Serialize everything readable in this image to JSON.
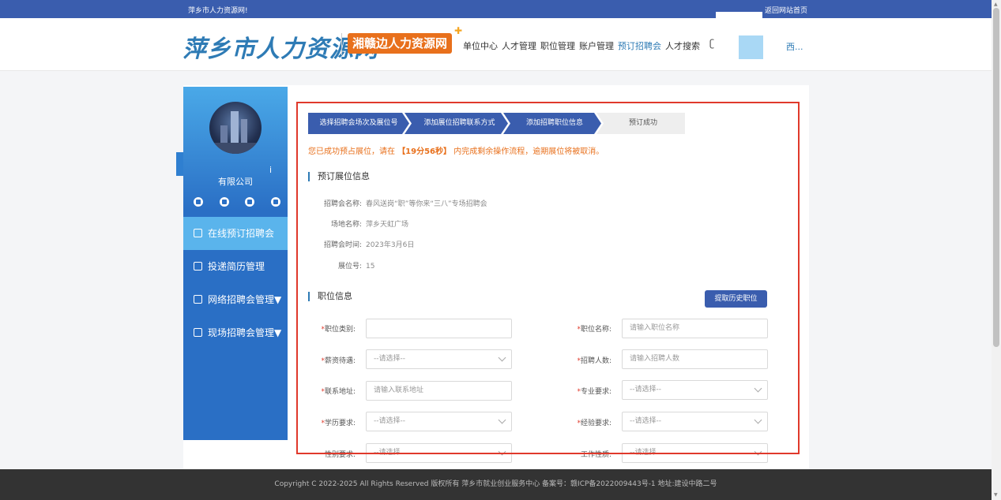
{
  "topbar": {
    "site_title": "萍乡市人力资源网!",
    "home_link": "返回网站首页"
  },
  "header": {
    "logo_main": "萍乡市人力资源网",
    "logo_badge": "湘赣边人力资源网",
    "nav": [
      "单位中心",
      "人才管理",
      "职位管理",
      "账户管理",
      "预订招聘会",
      "人才搜索"
    ],
    "nav_active_index": 4,
    "user_name": "西..."
  },
  "sidebar": {
    "info_mark": "i",
    "company": "有限公司",
    "menu": [
      {
        "label": "在线预订招聘会",
        "active": true
      },
      {
        "label": "投递简历管理",
        "active": false
      },
      {
        "label": "网络招聘会管理▼",
        "active": false
      },
      {
        "label": "现场招聘会管理▼",
        "active": false
      }
    ]
  },
  "steps": [
    "选择招聘会场次及展位号",
    "添加展位招聘联系方式",
    "添加招聘职位信息",
    "预订成功"
  ],
  "notice": {
    "prefix": "您已成功预占展位，请在",
    "timer": "【19分56秒】",
    "suffix": "内完成剩余操作流程，逾期展位将被取消。"
  },
  "booth_info": {
    "title": "预订展位信息",
    "rows": [
      {
        "label": "招聘会名称:",
        "value": "春风送岗“职”等你来“三八”专场招聘会"
      },
      {
        "label": "场地名称:",
        "value": "萍乡天虹广场"
      },
      {
        "label": "招聘会时间:",
        "value": "2023年3月6日"
      },
      {
        "label": "展位号:",
        "value": "15"
      }
    ]
  },
  "job_info": {
    "title": "职位信息",
    "history_button": "提取历史职位",
    "fields": {
      "job_category": {
        "label": "职位类别:",
        "value": ""
      },
      "job_name": {
        "label": "职位名称:",
        "placeholder": "请输入职位名称"
      },
      "salary": {
        "label": "薪资待遇:",
        "value": "--请选择--"
      },
      "headcount": {
        "label": "招聘人数:",
        "placeholder": "请输入招聘人数"
      },
      "address": {
        "label": "联系地址:",
        "placeholder": "请输入联系地址"
      },
      "major": {
        "label": "专业要求:",
        "value": "--请选择--"
      },
      "education": {
        "label": "学历要求:",
        "value": "--请选择--"
      },
      "experience": {
        "label": "经验要求:",
        "value": "--请选择--"
      },
      "gender": {
        "label": "性别要求:",
        "value": "--请选择"
      },
      "job_type": {
        "label": "工作性质:",
        "value": "--请选择"
      }
    }
  },
  "footer": {
    "text": "Copyright C 2022-2025 All Rights Reserved 版权所有 萍乡市就业创业服务中心 备案号：赣ICP备2022009443号-1 地址:建设中路二号"
  }
}
